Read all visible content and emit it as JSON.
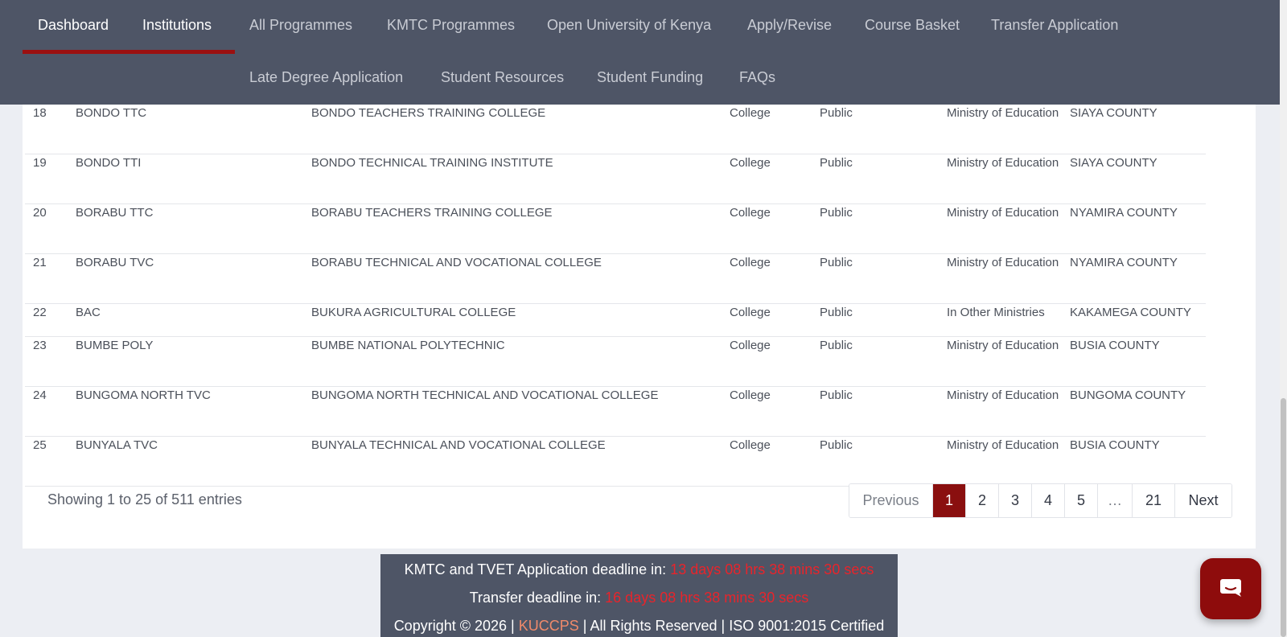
{
  "nav": {
    "row1": [
      "Dashboard",
      "Institutions",
      "All Programmes",
      "KMTC Programmes",
      "Open University of Kenya",
      "Apply/Revise",
      "Course Basket",
      "Transfer Application"
    ],
    "row2": [
      "Late Degree Application",
      "Student Resources",
      "Student Funding",
      "FAQs"
    ]
  },
  "table": {
    "rows": [
      {
        "num": "18",
        "abbr": "BONDO TTC",
        "name": "BONDO TEACHERS TRAINING COLLEGE",
        "type": "College",
        "category": "Public",
        "ministry": "Ministry of Education",
        "county": "SIAYA COUNTY"
      },
      {
        "num": "19",
        "abbr": "BONDO TTI",
        "name": "BONDO TECHNICAL TRAINING INSTITUTE",
        "type": "College",
        "category": "Public",
        "ministry": "Ministry of Education",
        "county": "SIAYA COUNTY"
      },
      {
        "num": "20",
        "abbr": "BORABU TTC",
        "name": "BORABU TEACHERS TRAINING COLLEGE",
        "type": "College",
        "category": "Public",
        "ministry": "Ministry of Education",
        "county": "NYAMIRA COUNTY"
      },
      {
        "num": "21",
        "abbr": "BORABU TVC",
        "name": "BORABU TECHNICAL AND VOCATIONAL COLLEGE",
        "type": "College",
        "category": "Public",
        "ministry": "Ministry of Education",
        "county": "NYAMIRA COUNTY"
      },
      {
        "num": "22",
        "abbr": "BAC",
        "name": "BUKURA AGRICULTURAL COLLEGE",
        "type": "College",
        "category": "Public",
        "ministry": "In Other Ministries",
        "county": "KAKAMEGA COUNTY"
      },
      {
        "num": "23",
        "abbr": "BUMBE POLY",
        "name": "BUMBE NATIONAL POLYTECHNIC",
        "type": "College",
        "category": "Public",
        "ministry": "Ministry of Education",
        "county": "BUSIA COUNTY"
      },
      {
        "num": "24",
        "abbr": "BUNGOMA NORTH TVC",
        "name": "BUNGOMA NORTH TECHNICAL AND VOCATIONAL COLLEGE",
        "type": "College",
        "category": "Public",
        "ministry": "Ministry of Education",
        "county": "BUNGOMA COUNTY"
      },
      {
        "num": "25",
        "abbr": "BUNYALA TVC",
        "name": "BUNYALA TECHNICAL AND VOCATIONAL COLLEGE",
        "type": "College",
        "category": "Public",
        "ministry": "Ministry of Education",
        "county": "BUSIA COUNTY"
      }
    ]
  },
  "pagination": {
    "showing": "Showing 1 to 25 of 511 entries",
    "previous": "Previous",
    "pages": [
      "1",
      "2",
      "3",
      "4",
      "5",
      "…",
      "21"
    ],
    "next": "Next"
  },
  "footer": {
    "kmtc_label": "KMTC and TVET Application deadline in:",
    "kmtc_countdown": "13 days 08 hrs 38 mins 30 secs",
    "transfer_label": "Transfer deadline in:",
    "transfer_countdown": "16 days 08 hrs 38 mins 30 secs",
    "copyright_prefix": "Copyright © 2026 |",
    "kuccps_link": "KUCCPS",
    "copyright_suffix": "| All Rights Reserved | ISO 9001:2015 Certified"
  },
  "colors": {
    "nav_bg": "#4e5566",
    "accent": "#8a0f0f",
    "countdown": "#e8242b"
  },
  "chat": {
    "icon": "chat-bubble-icon"
  }
}
